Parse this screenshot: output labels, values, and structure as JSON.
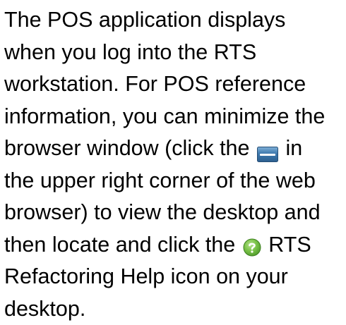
{
  "document": {
    "lines": [
      "The POS application displays",
      "when you log into the RTS",
      "workstation. For POS reference",
      "information, you can minimize the",
      "browser window (click the",
      "in",
      "the upper right corner of the web",
      "browser) to view the desktop and",
      "then locate and click the",
      "RTS",
      "Refactoring Help icon on your",
      "desktop."
    ]
  },
  "icons": {
    "minimize": "minimize-button-icon",
    "help": "help-question-icon"
  },
  "colors": {
    "text": "#000000",
    "minimize_body": "#2d5f8f",
    "minimize_highlight": "#7fb0d8",
    "minimize_bar": "#ffffff",
    "help_outer": "#4f9a2a",
    "help_inner": "#7cc44a",
    "help_mark": "#ffffff"
  }
}
